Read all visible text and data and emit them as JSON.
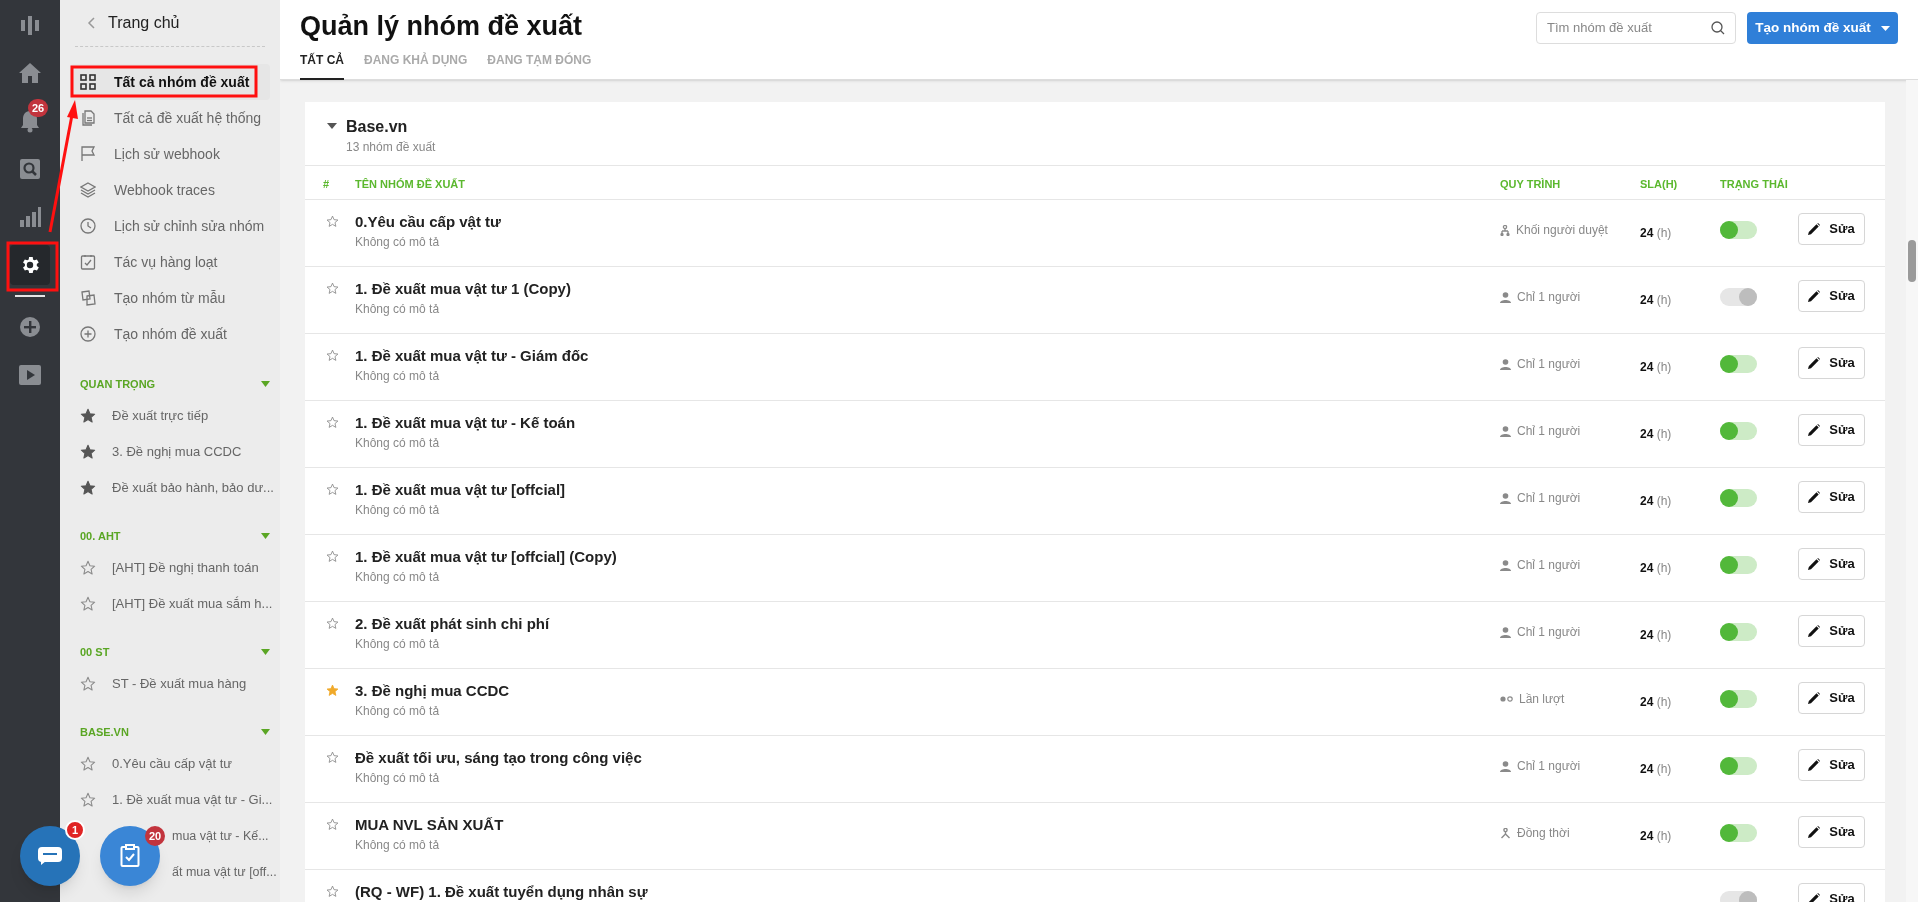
{
  "rail": {
    "items": [
      {
        "kind": "logo",
        "selected": false
      },
      {
        "kind": "home",
        "selected": false
      },
      {
        "kind": "bell",
        "selected": false,
        "badge": "26"
      },
      {
        "kind": "search",
        "selected": false
      },
      {
        "kind": "chart",
        "selected": false
      },
      {
        "kind": "gear",
        "selected": true
      },
      {
        "kind": "plus",
        "selected": false
      },
      {
        "kind": "play",
        "selected": false
      }
    ]
  },
  "sidebar": {
    "back_label": "Trang chủ",
    "items": [
      {
        "label": "Tất cả nhóm đề xuất",
        "selected": true
      },
      {
        "label": "Tất cả đề xuất hệ thống",
        "selected": false
      },
      {
        "label": "Lịch sử webhook",
        "selected": false
      },
      {
        "label": "Webhook traces",
        "selected": false
      },
      {
        "label": "Lịch sử chỉnh sửa nhóm",
        "selected": false
      },
      {
        "label": "Tác vụ hàng loạt",
        "selected": false
      },
      {
        "label": "Tạo nhóm từ mẫu",
        "selected": false
      },
      {
        "label": "Tạo nhóm đề xuất",
        "selected": false
      }
    ],
    "sections": [
      {
        "title": "QUAN TRỌNG",
        "expanded": true,
        "items": [
          {
            "label": "Đề xuất trực tiếp",
            "starred": true
          },
          {
            "label": "3. Đề nghị mua CCDC",
            "starred": true
          },
          {
            "label": "Đề xuất bảo hành, bảo dư...",
            "starred": true
          }
        ]
      },
      {
        "title": "00. AHT",
        "expanded": true,
        "items": [
          {
            "label": "[AHT] Đề nghị thanh toán",
            "starred": false
          },
          {
            "label": "[AHT] Đề xuất mua sắm h...",
            "starred": false
          }
        ]
      },
      {
        "title": "00 ST",
        "expanded": true,
        "items": [
          {
            "label": "ST - Đề xuất mua hàng",
            "starred": false
          }
        ]
      },
      {
        "title": "BASE.VN",
        "expanded": true,
        "items": [
          {
            "label": "0.Yêu cầu cấp vật tư",
            "starred": false
          },
          {
            "label": "1. Đề xuất mua vật tư - Gi...",
            "starred": false
          },
          {
            "label": "mua vật tư - Kế..."
          },
          {
            "label": "ất mua vật tư [off..."
          }
        ]
      }
    ]
  },
  "floating_buttons": [
    {
      "kind": "chat",
      "badge": "1"
    },
    {
      "kind": "tasks",
      "badge": "20"
    }
  ],
  "header": {
    "title": "Quản lý nhóm đề xuất",
    "tabs": [
      {
        "label": "TẤT CẢ",
        "selected": true
      },
      {
        "label": "ĐANG KHẢ DỤNG",
        "selected": false
      },
      {
        "label": "ĐANG TẠM ĐÓNG",
        "selected": false
      }
    ],
    "search": {
      "placeholder": "Tìm nhóm đề xuất"
    },
    "create_button": "Tạo nhóm đề xuất"
  },
  "group": {
    "name": "Base.vn",
    "count": "13 nhóm đề xuất",
    "expanded": true,
    "columns": [
      "#",
      "TÊN NHÓM ĐỀ XUẤT",
      "QUY TRÌNH",
      "SLA(H)",
      "TRẠNG THÁI"
    ],
    "rows": [
      {
        "name": "0.Yêu cầu cấp vật tư",
        "description": "Không có mô tả",
        "starred": false,
        "process": {
          "kind": "block",
          "label": "Khối người duyệt"
        },
        "sla": "24",
        "sla_unit": "(h)",
        "on": true,
        "action": "Sửa"
      },
      {
        "name": "1. Đề xuất mua vật tư 1 (Copy)",
        "description": "Không có mô tả",
        "starred": false,
        "process": {
          "kind": "single",
          "label": "Chỉ 1 người"
        },
        "sla": "24",
        "sla_unit": "(h)",
        "on": false,
        "action": "Sửa"
      },
      {
        "name": "1. Đề xuất mua vật tư - Giám đốc",
        "description": "Không có mô tả",
        "starred": false,
        "process": {
          "kind": "single",
          "label": "Chỉ 1 người"
        },
        "sla": "24",
        "sla_unit": "(h)",
        "on": true,
        "action": "Sửa"
      },
      {
        "name": "1. Đề xuất mua vật tư - Kế toán",
        "description": "Không có mô tả",
        "starred": false,
        "process": {
          "kind": "single",
          "label": "Chỉ 1 người"
        },
        "sla": "24",
        "sla_unit": "(h)",
        "on": true,
        "action": "Sửa"
      },
      {
        "name": "1. Đề xuất mua vật tư [offcial]",
        "description": "Không có mô tả",
        "starred": false,
        "process": {
          "kind": "single",
          "label": "Chỉ 1 người"
        },
        "sla": "24",
        "sla_unit": "(h)",
        "on": true,
        "action": "Sửa"
      },
      {
        "name": "1. Đề xuất mua vật tư [offcial] (Copy)",
        "description": "Không có mô tả",
        "starred": false,
        "process": {
          "kind": "single",
          "label": "Chỉ 1 người"
        },
        "sla": "24",
        "sla_unit": "(h)",
        "on": true,
        "action": "Sửa"
      },
      {
        "name": "2. Đề xuất phát sinh chi phí",
        "description": "Không có mô tả",
        "starred": false,
        "process": {
          "kind": "single",
          "label": "Chỉ 1 người"
        },
        "sla": "24",
        "sla_unit": "(h)",
        "on": true,
        "action": "Sửa"
      },
      {
        "name": "3. Đề nghị mua CCDC",
        "description": "Không có mô tả",
        "starred": true,
        "process": {
          "kind": "sequence",
          "label": "Lần lượt"
        },
        "sla": "24",
        "sla_unit": "(h)",
        "on": true,
        "action": "Sửa"
      },
      {
        "name": "Đề xuất tối ưu, sáng tạo trong công việc",
        "description": "Không có mô tả",
        "starred": false,
        "process": {
          "kind": "single",
          "label": "Chỉ 1 người"
        },
        "sla": "24",
        "sla_unit": "(h)",
        "on": true,
        "action": "Sửa"
      },
      {
        "name": "MUA NVL SẢN XUẤT",
        "description": "Không có mô tả",
        "starred": false,
        "process": {
          "kind": "parallel",
          "label": "Đồng thời"
        },
        "sla": "24",
        "sla_unit": "(h)",
        "on": true,
        "action": "Sửa"
      },
      {
        "name": "(RQ - WF) 1. Đề xuất tuyển dụng nhân sự",
        "starred": false,
        "on": false,
        "action": "Sửa"
      }
    ]
  }
}
